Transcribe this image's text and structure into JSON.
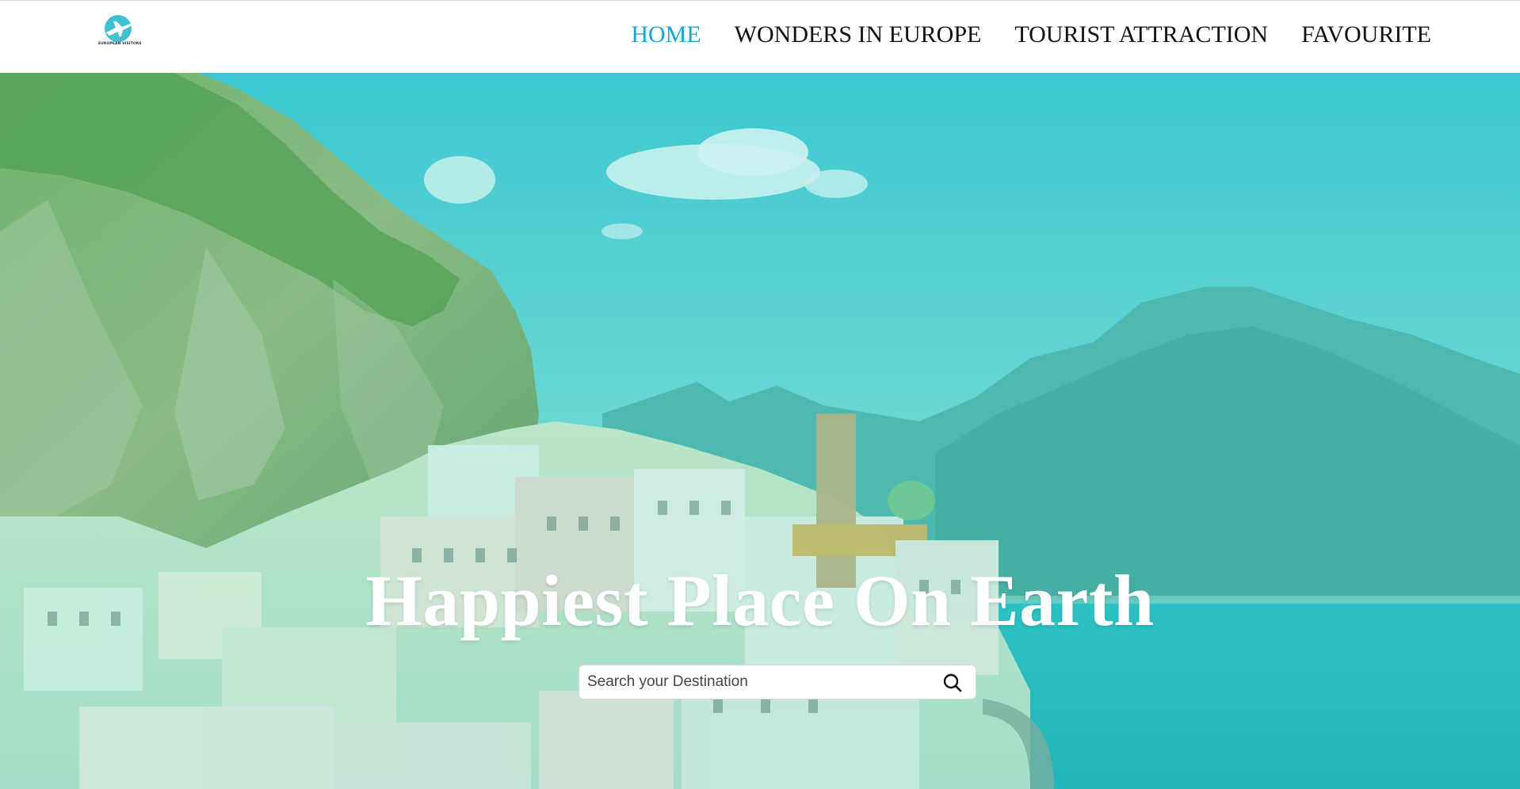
{
  "brand": {
    "logo_text": "EUROPEAN VISITORS",
    "logo_icon": "airplane-icon",
    "accent_color": "#1aa3d8"
  },
  "nav": {
    "items": [
      {
        "label": "HOME",
        "active": true
      },
      {
        "label": "WONDERS IN EUROPE",
        "active": false
      },
      {
        "label": "TOURIST ATTRACTION",
        "active": false
      },
      {
        "label": "FAVOURITE",
        "active": false
      }
    ]
  },
  "hero": {
    "title": "Happiest Place On Earth",
    "search": {
      "placeholder": "Search your Destination",
      "value": "",
      "icon": "search-icon"
    },
    "overlay_color": "#2ec6c8"
  }
}
